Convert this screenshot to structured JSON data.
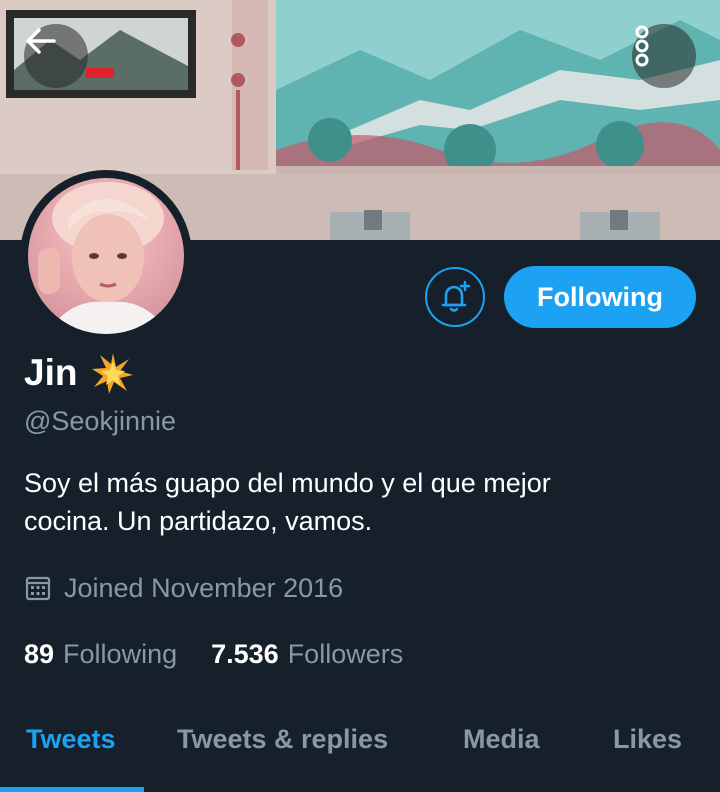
{
  "header": {
    "back_icon": "arrow-left-icon",
    "menu_icon": "more-vertical-icon"
  },
  "profile": {
    "display_name": "Jin",
    "name_emoji": "🌟",
    "handle": "@Seokjinnie",
    "bio_lines": [
      "Soy el más guapo del mundo y el que mejor",
      "cocina. Un partidazo, vamos."
    ],
    "joined": "Joined November 2016",
    "joined_icon": "calendar-icon"
  },
  "actions": {
    "notify_icon": "bell-plus-icon",
    "follow_label": "Following"
  },
  "stats": {
    "following_count": "89",
    "following_label": "Following",
    "followers_count": "7.536",
    "followers_label": "Followers"
  },
  "tabs": [
    {
      "label": "Tweets",
      "active": true
    },
    {
      "label": "Tweets & replies",
      "active": false
    },
    {
      "label": "Media",
      "active": false
    },
    {
      "label": "Likes",
      "active": false
    }
  ],
  "colors": {
    "background": "#15202b",
    "accent": "#1da1f2",
    "secondary_text": "#8899a6",
    "primary_text": "#ffffff"
  }
}
